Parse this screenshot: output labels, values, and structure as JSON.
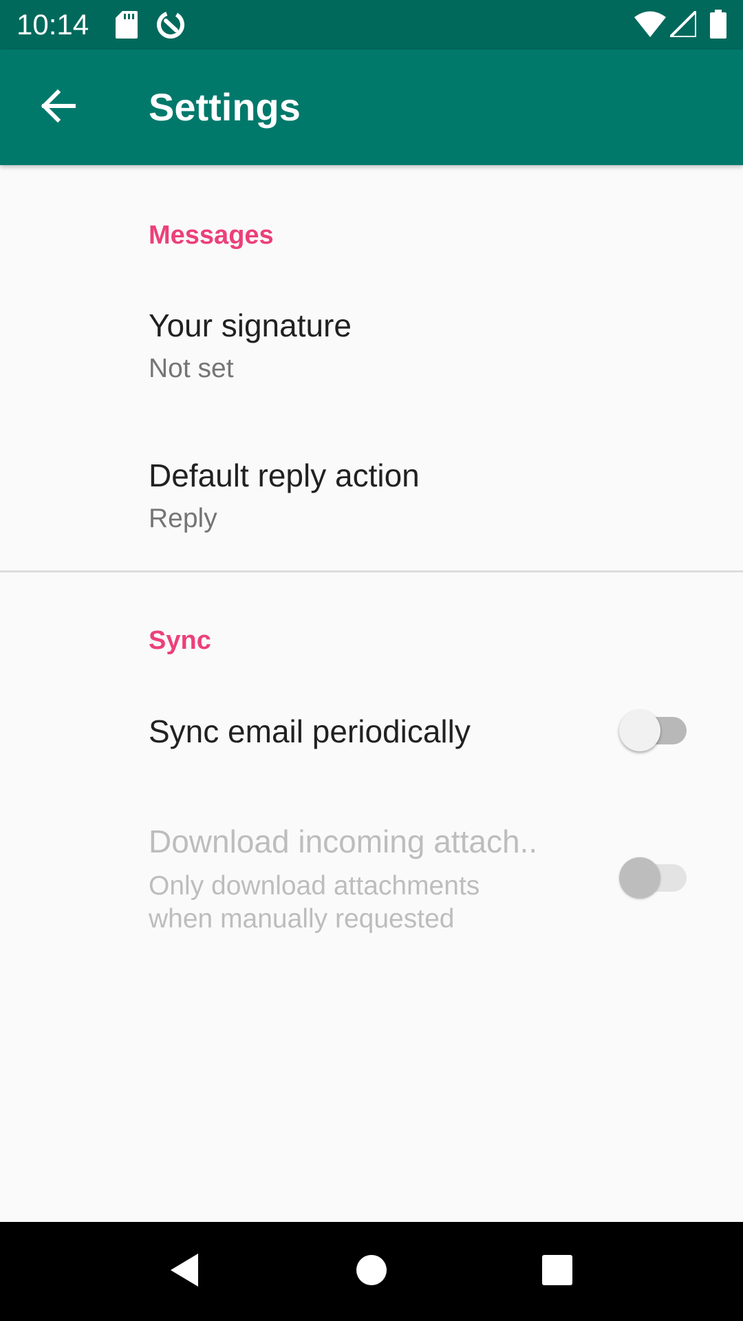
{
  "status_bar": {
    "time": "10:14",
    "icons": [
      "sd-card-icon",
      "data-saver-icon",
      "wifi-icon",
      "cell-signal-icon",
      "battery-icon"
    ]
  },
  "app_bar": {
    "back_icon": "arrow-back-icon",
    "title": "Settings"
  },
  "sections": [
    {
      "header": "Messages",
      "items": [
        {
          "title": "Your signature",
          "summary": "Not set"
        },
        {
          "title": "Default reply action",
          "summary": "Reply"
        }
      ]
    },
    {
      "header": "Sync",
      "items": [
        {
          "title": "Sync email periodically",
          "summary": "",
          "switch_on": false,
          "enabled": true
        },
        {
          "title": "Download incoming attach..",
          "summary_line1": "Only download attachments",
          "summary_line2": "when manually requested",
          "switch_on": false,
          "enabled": false
        }
      ]
    }
  ],
  "nav_bar": {
    "buttons": [
      "back-triangle-icon",
      "home-circle-icon",
      "recents-square-icon"
    ]
  },
  "colors": {
    "status_bar": "#00695c",
    "app_bar": "#00796b",
    "accent": "#ec407a",
    "background": "#fafafa"
  }
}
